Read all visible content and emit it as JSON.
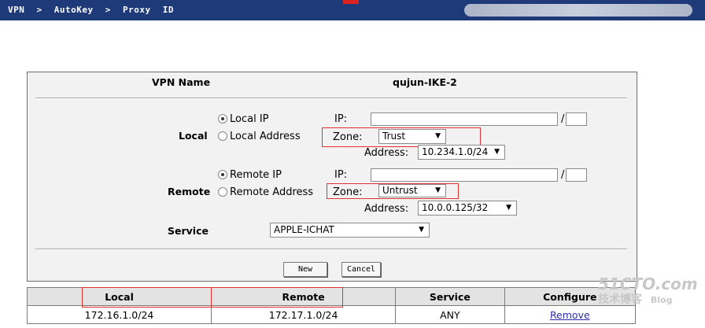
{
  "breadcrumb": {
    "items": [
      "VPN",
      "AutoKey",
      "Proxy",
      "ID"
    ],
    "sep": ">"
  },
  "form": {
    "vpn_name_label": "VPN Name",
    "vpn_name_value": "qujun-IKE-2",
    "local": {
      "section_label": "Local",
      "radio_ip_label": "Local IP",
      "radio_addr_label": "Local Address",
      "ip_label": "IP:",
      "ip_value": "",
      "slash": "/",
      "mask_value": "",
      "zone_label": "Zone:",
      "zone_value": "Trust",
      "address_label": "Address:",
      "address_value": "10.234.1.0/24"
    },
    "remote": {
      "section_label": "Remote",
      "radio_ip_label": "Remote IP",
      "radio_addr_label": "Remote Address",
      "ip_label": "IP:",
      "ip_value": "",
      "slash": "/",
      "mask_value": "",
      "zone_label": "Zone:",
      "zone_value": "Untrust",
      "address_label": "Address:",
      "address_value": "10.0.0.125/32"
    },
    "service_label": "Service",
    "service_value": "APPLE-ICHAT",
    "new_button": "New",
    "cancel_button": "Cancel"
  },
  "table": {
    "headers": [
      "Local",
      "Remote",
      "Service",
      "Configure"
    ],
    "rows": [
      {
        "local": "172.16.1.0/24",
        "remote": "172.17.1.0/24",
        "service": "ANY",
        "action": "Remove"
      }
    ]
  },
  "watermark": {
    "line1": "51CTO.com",
    "line2": "技术博客",
    "line3": "Blog"
  },
  "colors": {
    "header_bar": "#1f3a78",
    "highlight_border": "#e03030",
    "link": "#2b2bb0"
  }
}
